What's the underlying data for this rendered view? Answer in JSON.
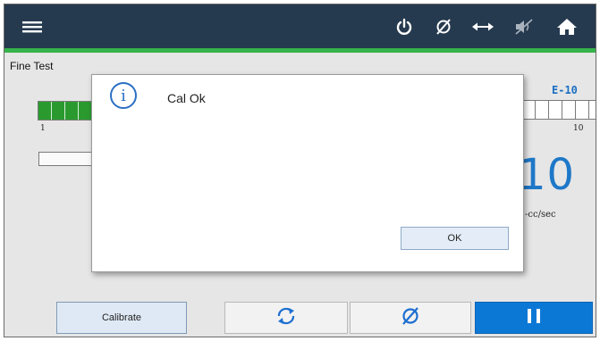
{
  "header": {
    "icons": [
      "menu-icon",
      "power-icon",
      "zero-icon",
      "horizontal-arrows-icon",
      "mute-icon",
      "home-icon"
    ]
  },
  "screen": {
    "title": "Fine Test"
  },
  "meters": {
    "left": {
      "segments": 10,
      "filled": 4,
      "tick": "1"
    },
    "right": {
      "segments": 6,
      "filled": 0,
      "tick": "10"
    },
    "range_label": "E-10"
  },
  "reading": {
    "value": "10",
    "unit": "-cc/sec"
  },
  "dialog": {
    "message": "Cal Ok",
    "ok_label": "OK",
    "icon": "info-icon"
  },
  "actions": {
    "calibrate_label": "Calibrate",
    "refresh_icon": "refresh-icon",
    "zero_icon": "zero-icon",
    "pause_icon": "pause-icon"
  },
  "colors": {
    "header_bg": "#263a4f",
    "accent_green": "#36b34a",
    "meter_fill": "#2a9a2f",
    "primary_blue": "#0c78d6",
    "value_blue": "#1e78c8"
  }
}
